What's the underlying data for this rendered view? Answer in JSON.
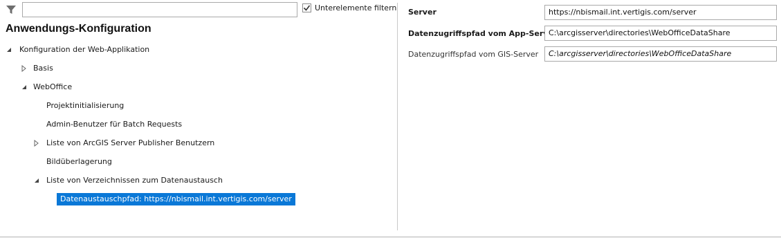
{
  "filter": {
    "icon": "filter-icon",
    "placeholder": "",
    "value": "",
    "checkbox_label": "Unterelemente filtern",
    "checkbox_checked": true
  },
  "section_title": "Anwendungs-Konfiguration",
  "tree": {
    "root": "Konfiguration der Web-Applikation",
    "basis": "Basis",
    "weboffice": "WebOffice",
    "projektinit": "Projektinitialisierung",
    "admin": "Admin-Benutzer für Batch Requests",
    "arcgis": "Liste von ArcGIS Server Publisher Benutzern",
    "bild": "Bildüberlagerung",
    "verzeichnisse": "Liste von Verzeichnissen zum Datenaustausch",
    "selected": "Datenaustauschpfad: https://nbismail.int.vertigis.com/server"
  },
  "properties": [
    {
      "label": "Server",
      "value": "https://nbismail.int.vertigis.com/server"
    },
    {
      "label": "Datenzugriffspfad vom App-Server",
      "value": "C:\\arcgisserver\\directories\\WebOfficeDataShare"
    },
    {
      "label": "Datenzugriffspfad vom GIS-Server",
      "value": "C:\\arcgisserver\\directories\\WebOfficeDataShare"
    }
  ],
  "colors": {
    "selection": "#0a78d7",
    "border": "#a9a9a9"
  }
}
